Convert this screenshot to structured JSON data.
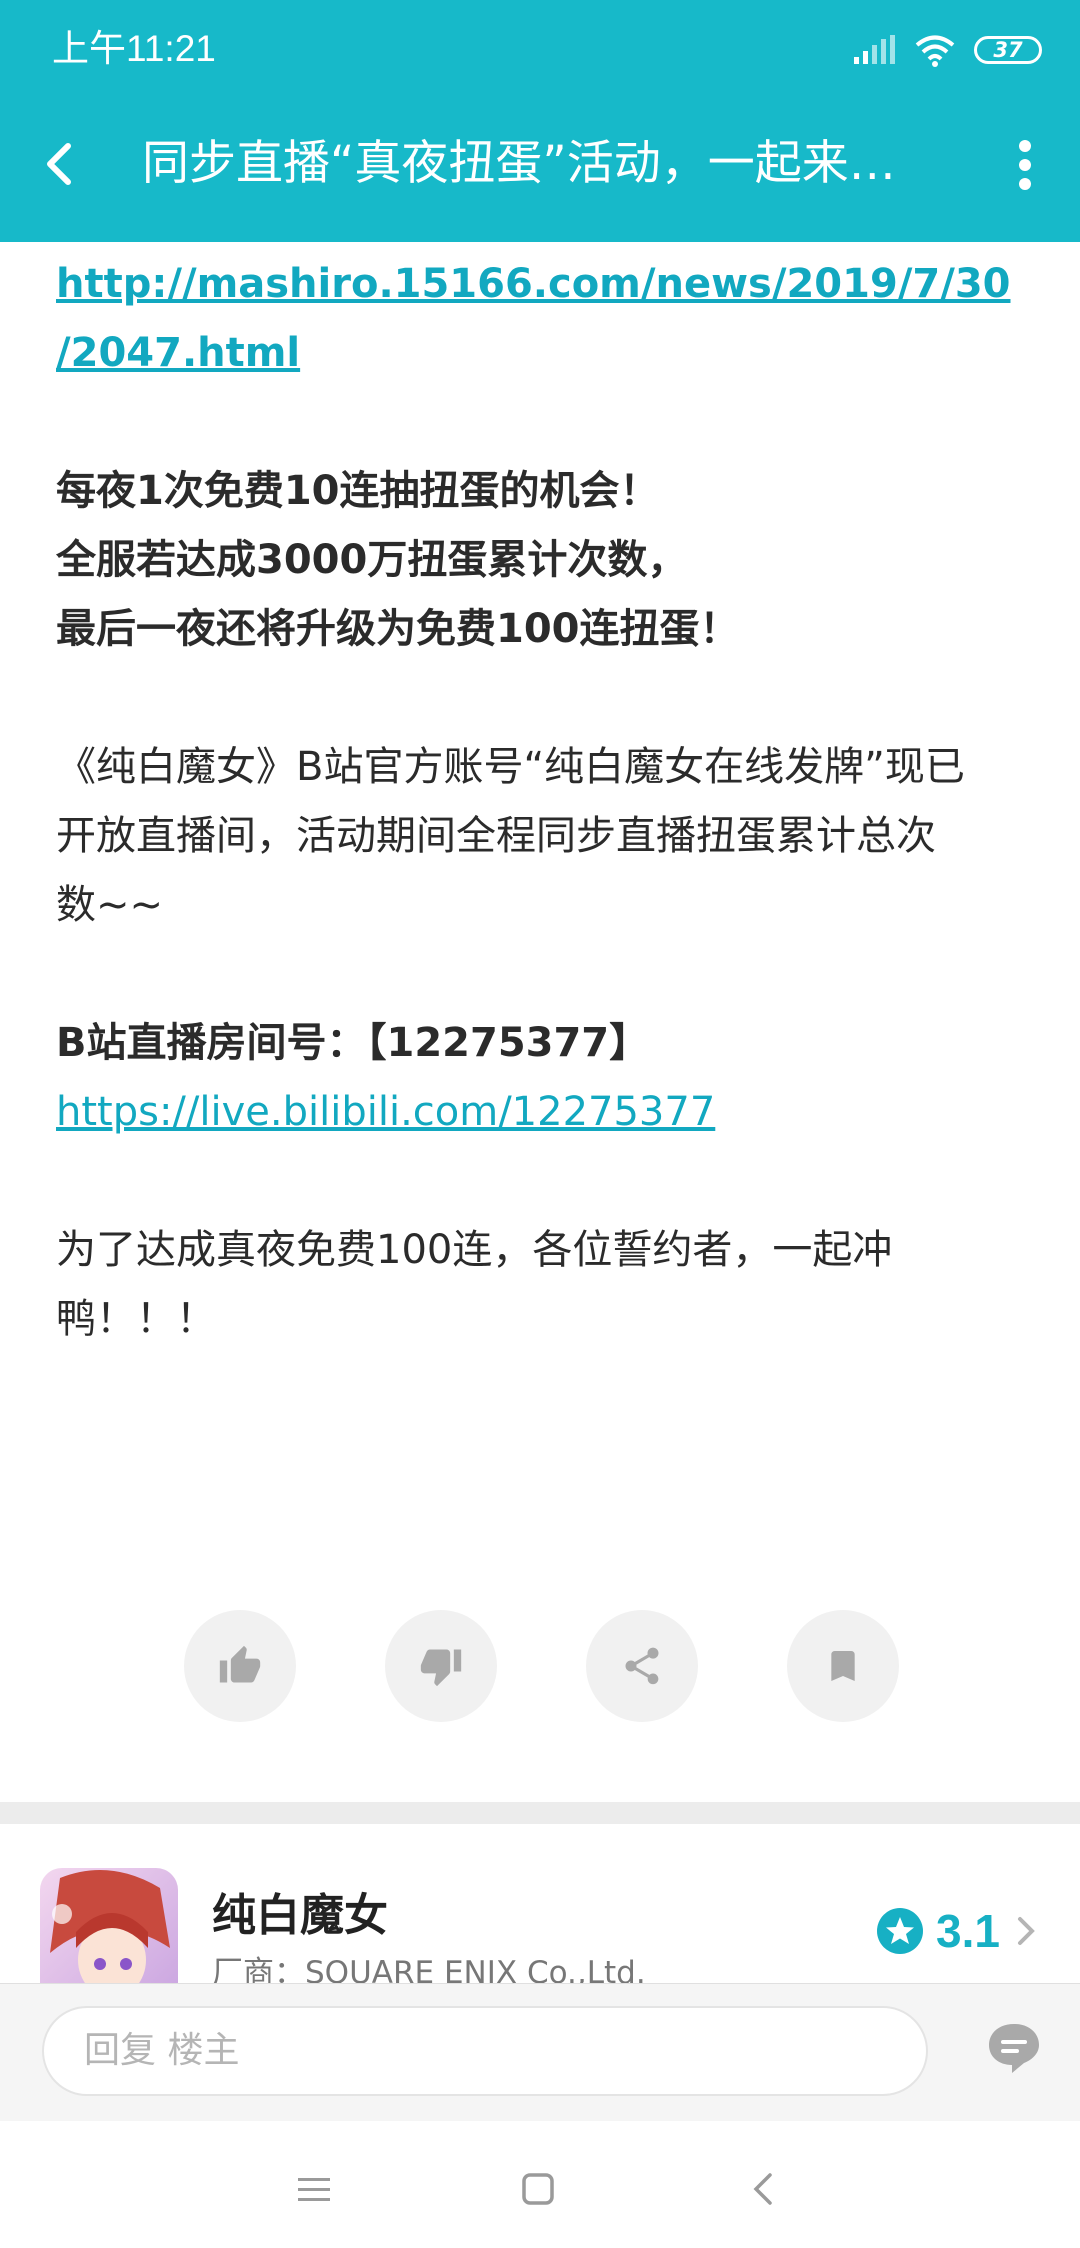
{
  "status_bar": {
    "time": "上午11:21",
    "battery": "37"
  },
  "navbar": {
    "title": "同步直播“真夜扭蛋”活动，一起来…"
  },
  "article": {
    "link1_line1": "http://mashiro.15166.com/news/2019/7/30",
    "link1_line2": "/2047.html",
    "bold_line1": "每夜1次免费10连抽扭蛋的机会！",
    "bold_line2": "全服若达成3000万扭蛋累计次数，",
    "bold_line3": "最后一夜还将升级为免费100连扭蛋！",
    "para_line1": "《纯白魔女》B站官方账号“纯白魔女在线发牌”现已",
    "para_line2": "开放直播间，活动期间全程同步直播扭蛋累计总次",
    "para_line3": "数~~",
    "room_label": "B站直播房间号：【12275377】",
    "room_link": "https://live.bilibili.com/12275377",
    "closing_line1": "为了达成真夜免费100连，各位誓约者，一起冲",
    "closing_line2": "鸭！！！"
  },
  "actions": {
    "icons": [
      "thumbs-up-icon",
      "thumbs-down-icon",
      "share-icon",
      "bookmark-icon"
    ]
  },
  "game_card": {
    "name": "纯白魔女",
    "vendor": "厂商：SQUARE ENIX Co.,Ltd.",
    "rating": "3.1"
  },
  "reply": {
    "placeholder": "回复  楼主"
  },
  "colors": {
    "accent": "#17b9c9",
    "link": "#12a8c0"
  }
}
